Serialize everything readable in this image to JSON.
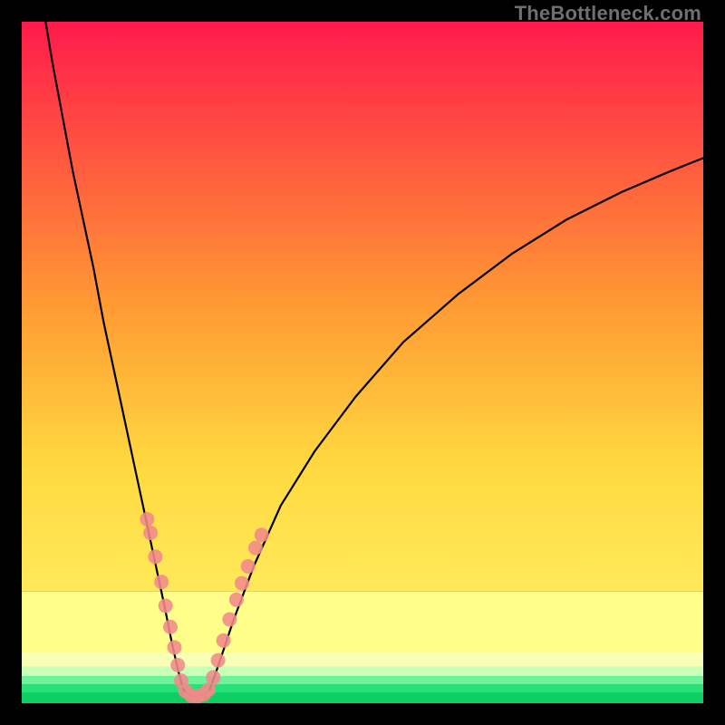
{
  "watermark": "TheBottleneck.com",
  "chart_data": {
    "type": "line",
    "title": "",
    "xlabel": "",
    "ylabel": "",
    "xlim": [
      0,
      100
    ],
    "ylim": [
      0,
      100
    ],
    "grid": false,
    "legend": false,
    "background_gradient": {
      "top_color": "#ff1a4b",
      "mid_color": "#ffd93f",
      "bottom_band_colors": [
        "#ffff8a",
        "#f8ffb7",
        "#c9ffb7",
        "#6ef39b",
        "#26e07a",
        "#0ed062"
      ],
      "bottom_band_heights_pct": [
        9.0,
        2.0,
        1.4,
        1.2,
        1.2,
        1.6
      ]
    },
    "series": [
      {
        "name": "left-branch",
        "x": [
          3.5,
          4.5,
          6.0,
          7.5,
          9.0,
          10.5,
          12.0,
          13.5,
          15.0,
          16.5,
          18.0,
          19.5,
          21.0,
          22.0,
          22.9,
          23.7
        ],
        "y": [
          100,
          94,
          86,
          78,
          71,
          64,
          56,
          49,
          42,
          35,
          28,
          21,
          14,
          9,
          5,
          2
        ],
        "stroke": "#000000",
        "stroke_width": 2.2
      },
      {
        "name": "valley-floor",
        "x": [
          23.7,
          24.6,
          25.6,
          26.6,
          27.6
        ],
        "y": [
          2,
          1.2,
          1.0,
          1.2,
          2
        ],
        "stroke": "#000000",
        "stroke_width": 2.2
      },
      {
        "name": "right-branch",
        "x": [
          27.6,
          29.0,
          31.0,
          34.0,
          38.0,
          43.0,
          49.0,
          56.0,
          64.0,
          72.0,
          80.0,
          88.0,
          95.0,
          100.0
        ],
        "y": [
          2,
          6,
          12,
          20,
          29,
          37,
          45,
          53,
          60,
          66,
          71,
          75,
          78,
          80
        ],
        "stroke": "#000000",
        "stroke_width": 2.2
      }
    ],
    "markers": [
      {
        "name": "left-marker-cluster",
        "color": "#f18a8a",
        "opacity": 0.88,
        "radius": 8,
        "points": [
          {
            "x": 18.4,
            "y": 27.0
          },
          {
            "x": 18.9,
            "y": 25.0
          },
          {
            "x": 19.6,
            "y": 21.5
          },
          {
            "x": 20.5,
            "y": 17.8
          },
          {
            "x": 21.1,
            "y": 14.3
          },
          {
            "x": 21.8,
            "y": 11.2
          },
          {
            "x": 22.4,
            "y": 8.2
          },
          {
            "x": 22.9,
            "y": 5.6
          },
          {
            "x": 23.4,
            "y": 3.3
          }
        ]
      },
      {
        "name": "valley-floor-markers",
        "color": "#f18a8a",
        "opacity": 0.88,
        "radius": 8,
        "points": [
          {
            "x": 24.0,
            "y": 1.8
          },
          {
            "x": 24.9,
            "y": 1.1
          },
          {
            "x": 25.8,
            "y": 1.0
          },
          {
            "x": 26.7,
            "y": 1.3
          },
          {
            "x": 27.4,
            "y": 2.0
          }
        ]
      },
      {
        "name": "right-marker-cluster",
        "color": "#f18a8a",
        "opacity": 0.88,
        "radius": 8,
        "points": [
          {
            "x": 28.1,
            "y": 3.8
          },
          {
            "x": 28.8,
            "y": 6.3
          },
          {
            "x": 29.6,
            "y": 9.2
          },
          {
            "x": 30.5,
            "y": 12.3
          },
          {
            "x": 31.5,
            "y": 15.2
          },
          {
            "x": 32.3,
            "y": 17.6
          },
          {
            "x": 33.2,
            "y": 20.1
          },
          {
            "x": 34.3,
            "y": 22.8
          },
          {
            "x": 35.2,
            "y": 24.7
          }
        ]
      }
    ]
  }
}
